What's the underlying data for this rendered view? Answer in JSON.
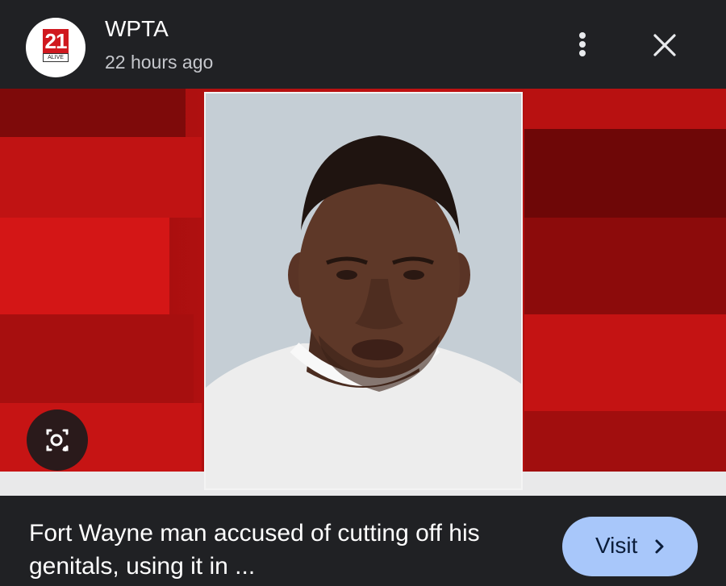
{
  "header": {
    "logo": {
      "number": "21",
      "word": "ALIVE"
    },
    "source_name": "WPTA",
    "timestamp": "22 hours ago",
    "icons": {
      "more": "more-vert-icon",
      "close": "close-icon"
    }
  },
  "image": {
    "description_icon": "lens-search-icon",
    "background_color": "#b21010"
  },
  "footer": {
    "headline": "Fort Wayne man accused of cutting off his genitals, using it in ...",
    "visit_label": "Visit",
    "visit_icon": "chevron-right-icon",
    "visit_color": "#a8c7fa"
  }
}
